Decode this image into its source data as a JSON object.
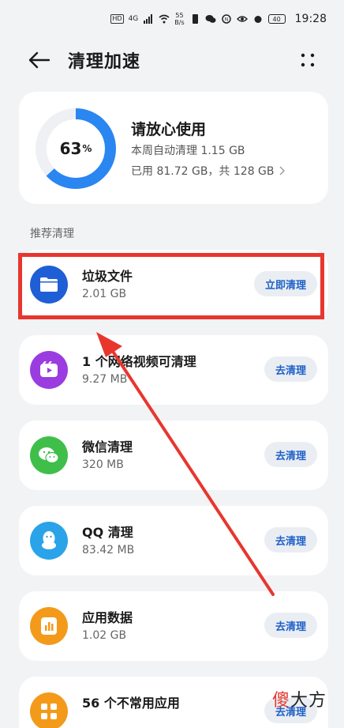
{
  "status_bar": {
    "hd": "HD",
    "signal": "4G",
    "rate_top": "55",
    "rate_bottom": "B/s",
    "battery": "40",
    "time": "19:28"
  },
  "header": {
    "title": "清理加速"
  },
  "summary": {
    "percent": "63",
    "percent_unit": "%",
    "percent_value": 0.63,
    "title": "请放心使用",
    "weekly_clean": "本周自动清理 1.15 GB",
    "usage": "已用 81.72 GB，共 128 GB"
  },
  "section_label": "推荐清理",
  "items": [
    {
      "title": "垃圾文件",
      "sub": "2.01 GB",
      "button": "立即清理",
      "color": "#1f5fd6",
      "icon": "folder-icon"
    },
    {
      "title": "1 个网络视频可清理",
      "sub": "9.27 MB",
      "button": "去清理",
      "color": "#9b3ce0",
      "icon": "video-icon"
    },
    {
      "title": "微信清理",
      "sub": "320 MB",
      "button": "去清理",
      "color": "#3fbf4a",
      "icon": "wechat-icon"
    },
    {
      "title": "QQ 清理",
      "sub": "83.42 MB",
      "button": "去清理",
      "color": "#2aa3e8",
      "icon": "qq-icon"
    },
    {
      "title": "应用数据",
      "sub": "1.02 GB",
      "button": "去清理",
      "color": "#f39a1a",
      "icon": "app-data-icon"
    },
    {
      "title": "56 个不常用应用",
      "sub": "",
      "button": "去清理",
      "color": "#f39a1a",
      "icon": "apps-grid-icon"
    }
  ],
  "watermark": {
    "part1": "傻",
    "part2": "大方"
  },
  "colors": {
    "accent": "#1e60c8",
    "highlight": "#e8362e",
    "ring": "#2a86f0"
  }
}
